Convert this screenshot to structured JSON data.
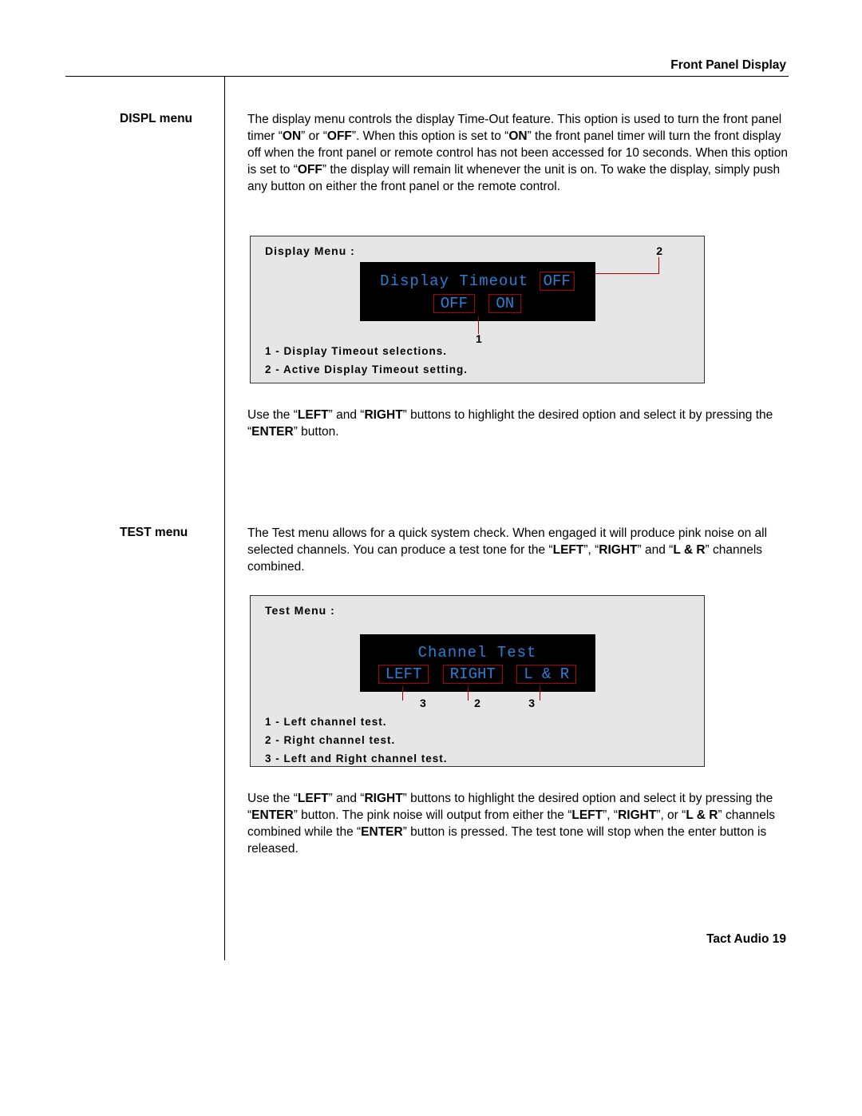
{
  "header": "Front Panel Display",
  "sidebar": {
    "displ": "DISPL menu",
    "test": "TEST menu"
  },
  "para1_a": "The display menu controls the display Time-Out feature. This option is used to turn the front panel  timer “",
  "on": "ON",
  "para1_b": "” or “",
  "off": "OFF",
  "para1_c": "”. When this option is set to “",
  "para1_d": "” the front panel timer will turn the front display off when the front panel or remote control has  not been accessed for 10 seconds.  When this option is set to “",
  "para1_e": "” the display will remain lit whenever the unit is on. To wake the display, simply  push any button on either the front panel or the remote control.",
  "panel1": {
    "title": "Display Menu :",
    "callout2": "2",
    "sc_title": "Display Timeout",
    "sc_val": "OFF",
    "opt_off": "OFF",
    "opt_on": "ON",
    "callout1": "1",
    "leg1": "1 - Display Timeout selections.",
    "leg2": "2 - Active Display Timeout setting."
  },
  "para2_a": "Use the “",
  "left": "LEFT",
  "para2_b": "” and “",
  "right": "RIGHT",
  "para2_c": "” buttons to highlight the desired option and select it by pressing the “",
  "enter": "ENTER",
  "para2_d": "” button.",
  "para3_a": "The Test menu allows for a quick system check. When engaged it will produce pink noise on all selected channels. You can produce a test tone for the “",
  "para3_b": "”, “",
  "para3_c": "” and “",
  "lr": "L & R",
  "para3_d": "” channels combined.",
  "panel2": {
    "title": "Test Menu :",
    "sc_title": "Channel Test",
    "opt_left": "LEFT",
    "opt_right": "RIGHT",
    "opt_lr": "L & R",
    "c3a": "3",
    "c2": "2",
    "c3b": "3",
    "leg1": "1 - Left channel test.",
    "leg2": "2 - Right channel test.",
    "leg3": "3 - Left and Right channel test."
  },
  "para4_a": "Use the “",
  "para4_b": "” and “",
  "para4_c": "” buttons to highlight the desired option and select it by pressing the “",
  "para4_d": "” button. The pink noise will output from either the “",
  "para4_e": "”, “",
  "para4_f": "”, or “",
  "para4_g": "” channels combined while the “",
  "para4_h": "” button is pressed.  The test tone will stop when the enter button is released.",
  "footer_a": "Tact Audio",
  "footer_b": "19"
}
